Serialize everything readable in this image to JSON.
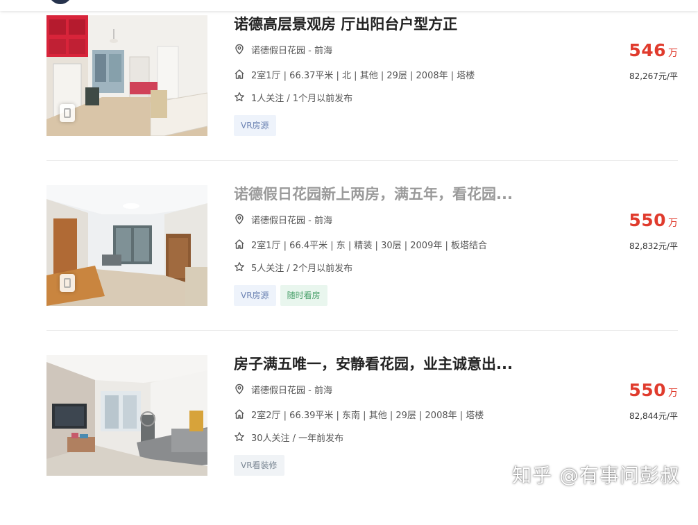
{
  "listings": [
    {
      "title": "诺德高层景观房 厅出阳台户型方正",
      "community": "诺德假日花园 - 前海",
      "house_info": "2室1厅 | 66.37平米 | 北 | 其他 | 29层 | 2008年 | 塔楼",
      "follow_info": "1人关注 / 1个月以前发布",
      "tags": [
        "VR房源"
      ],
      "price": "546",
      "price_unit": "万",
      "unit_price": "82,267元/平"
    },
    {
      "title": "诺德假日花园新上两房，满五年，看花园...",
      "community": "诺德假日花园 - 前海",
      "house_info": "2室1厅 | 66.4平米 | 东 | 精装 | 30层 | 2009年 | 板塔结合",
      "follow_info": "5人关注 / 2个月以前发布",
      "tags": [
        "VR房源",
        "随时看房"
      ],
      "price": "550",
      "price_unit": "万",
      "unit_price": "82,832元/平"
    },
    {
      "title": "房子满五唯一，安静看花园，业主诚意出...",
      "community": "诺德假日花园 - 前海",
      "house_info": "2室2厅 | 66.39平米 | 东南 | 其他 | 29层 | 2008年 | 塔楼",
      "follow_info": "30人关注 / 一年前发布",
      "tags": [
        "VR看装修"
      ],
      "price": "550",
      "price_unit": "万",
      "unit_price": "82,844元/平"
    }
  ],
  "watermark": "知乎 @有事问彭叔",
  "icons": {
    "location": "location-pin-icon",
    "house": "house-icon",
    "follow": "star-icon",
    "vr": "vr-badge-icon"
  },
  "colors": {
    "price": "#e03b2d",
    "tag_vr_bg": "#eef3fb",
    "tag_anytime_bg": "#e9f6ee",
    "tag_deco_bg": "#f0f3f6"
  }
}
